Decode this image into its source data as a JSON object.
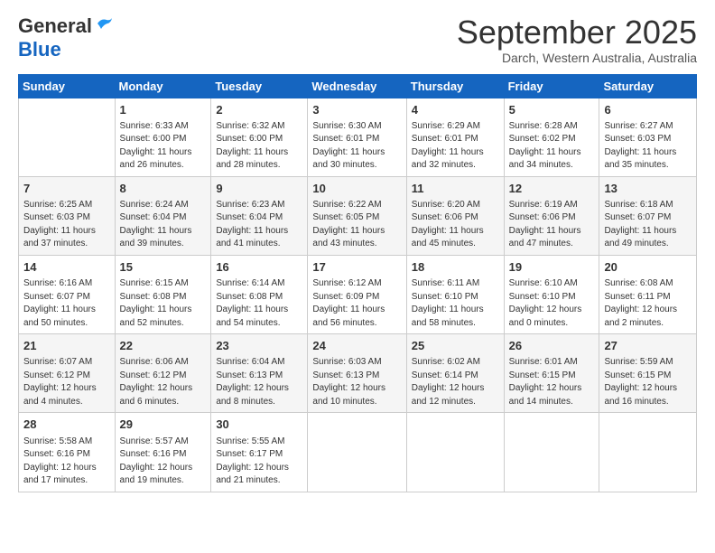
{
  "header": {
    "logo_general": "General",
    "logo_blue": "Blue",
    "month": "September 2025",
    "location": "Darch, Western Australia, Australia"
  },
  "days_of_week": [
    "Sunday",
    "Monday",
    "Tuesday",
    "Wednesday",
    "Thursday",
    "Friday",
    "Saturday"
  ],
  "weeks": [
    [
      {
        "day": "",
        "info": ""
      },
      {
        "day": "1",
        "info": "Sunrise: 6:33 AM\nSunset: 6:00 PM\nDaylight: 11 hours\nand 26 minutes."
      },
      {
        "day": "2",
        "info": "Sunrise: 6:32 AM\nSunset: 6:00 PM\nDaylight: 11 hours\nand 28 minutes."
      },
      {
        "day": "3",
        "info": "Sunrise: 6:30 AM\nSunset: 6:01 PM\nDaylight: 11 hours\nand 30 minutes."
      },
      {
        "day": "4",
        "info": "Sunrise: 6:29 AM\nSunset: 6:01 PM\nDaylight: 11 hours\nand 32 minutes."
      },
      {
        "day": "5",
        "info": "Sunrise: 6:28 AM\nSunset: 6:02 PM\nDaylight: 11 hours\nand 34 minutes."
      },
      {
        "day": "6",
        "info": "Sunrise: 6:27 AM\nSunset: 6:03 PM\nDaylight: 11 hours\nand 35 minutes."
      }
    ],
    [
      {
        "day": "7",
        "info": "Sunrise: 6:25 AM\nSunset: 6:03 PM\nDaylight: 11 hours\nand 37 minutes."
      },
      {
        "day": "8",
        "info": "Sunrise: 6:24 AM\nSunset: 6:04 PM\nDaylight: 11 hours\nand 39 minutes."
      },
      {
        "day": "9",
        "info": "Sunrise: 6:23 AM\nSunset: 6:04 PM\nDaylight: 11 hours\nand 41 minutes."
      },
      {
        "day": "10",
        "info": "Sunrise: 6:22 AM\nSunset: 6:05 PM\nDaylight: 11 hours\nand 43 minutes."
      },
      {
        "day": "11",
        "info": "Sunrise: 6:20 AM\nSunset: 6:06 PM\nDaylight: 11 hours\nand 45 minutes."
      },
      {
        "day": "12",
        "info": "Sunrise: 6:19 AM\nSunset: 6:06 PM\nDaylight: 11 hours\nand 47 minutes."
      },
      {
        "day": "13",
        "info": "Sunrise: 6:18 AM\nSunset: 6:07 PM\nDaylight: 11 hours\nand 49 minutes."
      }
    ],
    [
      {
        "day": "14",
        "info": "Sunrise: 6:16 AM\nSunset: 6:07 PM\nDaylight: 11 hours\nand 50 minutes."
      },
      {
        "day": "15",
        "info": "Sunrise: 6:15 AM\nSunset: 6:08 PM\nDaylight: 11 hours\nand 52 minutes."
      },
      {
        "day": "16",
        "info": "Sunrise: 6:14 AM\nSunset: 6:08 PM\nDaylight: 11 hours\nand 54 minutes."
      },
      {
        "day": "17",
        "info": "Sunrise: 6:12 AM\nSunset: 6:09 PM\nDaylight: 11 hours\nand 56 minutes."
      },
      {
        "day": "18",
        "info": "Sunrise: 6:11 AM\nSunset: 6:10 PM\nDaylight: 11 hours\nand 58 minutes."
      },
      {
        "day": "19",
        "info": "Sunrise: 6:10 AM\nSunset: 6:10 PM\nDaylight: 12 hours\nand 0 minutes."
      },
      {
        "day": "20",
        "info": "Sunrise: 6:08 AM\nSunset: 6:11 PM\nDaylight: 12 hours\nand 2 minutes."
      }
    ],
    [
      {
        "day": "21",
        "info": "Sunrise: 6:07 AM\nSunset: 6:12 PM\nDaylight: 12 hours\nand 4 minutes."
      },
      {
        "day": "22",
        "info": "Sunrise: 6:06 AM\nSunset: 6:12 PM\nDaylight: 12 hours\nand 6 minutes."
      },
      {
        "day": "23",
        "info": "Sunrise: 6:04 AM\nSunset: 6:13 PM\nDaylight: 12 hours\nand 8 minutes."
      },
      {
        "day": "24",
        "info": "Sunrise: 6:03 AM\nSunset: 6:13 PM\nDaylight: 12 hours\nand 10 minutes."
      },
      {
        "day": "25",
        "info": "Sunrise: 6:02 AM\nSunset: 6:14 PM\nDaylight: 12 hours\nand 12 minutes."
      },
      {
        "day": "26",
        "info": "Sunrise: 6:01 AM\nSunset: 6:15 PM\nDaylight: 12 hours\nand 14 minutes."
      },
      {
        "day": "27",
        "info": "Sunrise: 5:59 AM\nSunset: 6:15 PM\nDaylight: 12 hours\nand 16 minutes."
      }
    ],
    [
      {
        "day": "28",
        "info": "Sunrise: 5:58 AM\nSunset: 6:16 PM\nDaylight: 12 hours\nand 17 minutes."
      },
      {
        "day": "29",
        "info": "Sunrise: 5:57 AM\nSunset: 6:16 PM\nDaylight: 12 hours\nand 19 minutes."
      },
      {
        "day": "30",
        "info": "Sunrise: 5:55 AM\nSunset: 6:17 PM\nDaylight: 12 hours\nand 21 minutes."
      },
      {
        "day": "",
        "info": ""
      },
      {
        "day": "",
        "info": ""
      },
      {
        "day": "",
        "info": ""
      },
      {
        "day": "",
        "info": ""
      }
    ]
  ]
}
